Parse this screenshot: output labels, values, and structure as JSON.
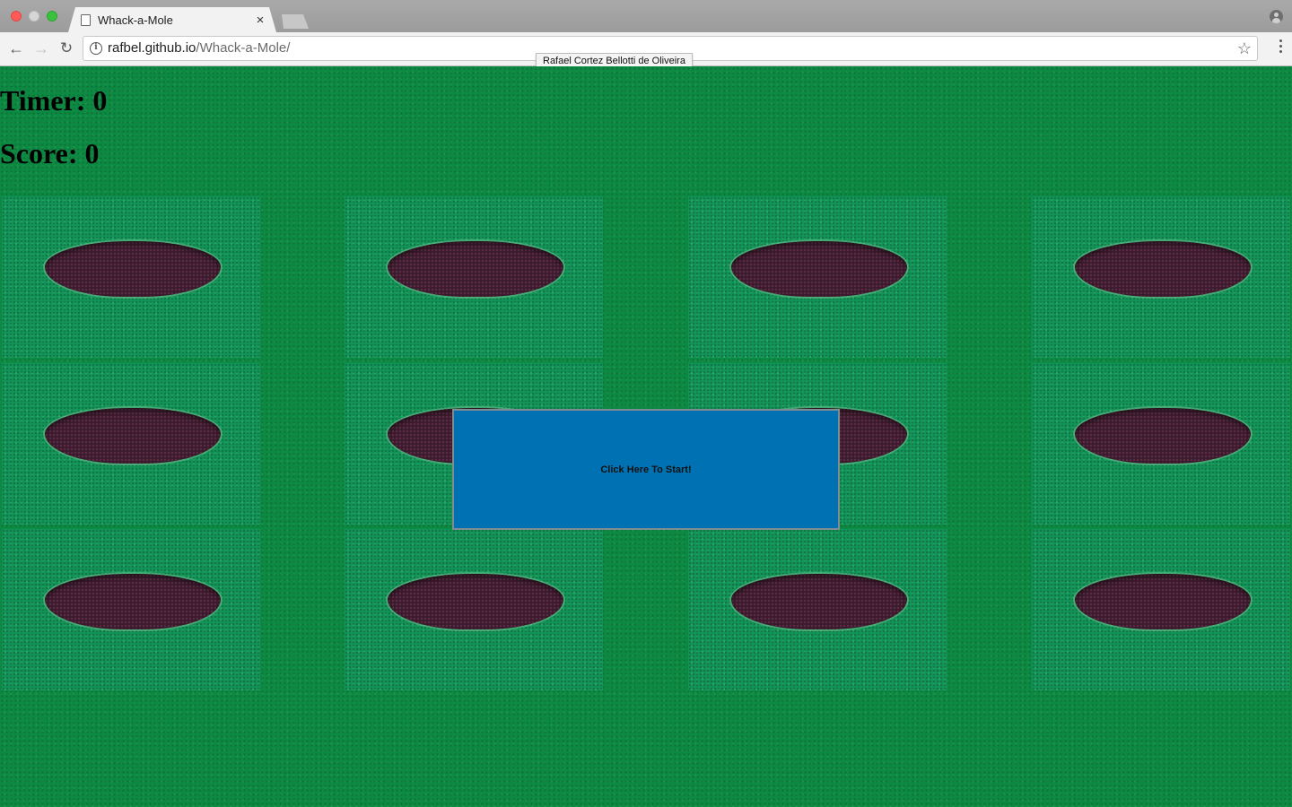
{
  "browser": {
    "tab_title": "Whack-a-Mole",
    "url_host": "rafbel.github.io",
    "url_path": "/Whack-a-Mole/",
    "tooltip": "Rafael Cortez Bellotti de Oliveira"
  },
  "game": {
    "timer_label": "Timer: 0",
    "score_label": "Score: 0",
    "start_button_label": "Click Here To Start!",
    "holes_rows": 3,
    "holes_cols": 4
  },
  "colors": {
    "field_green": "#0c8a43",
    "cell_green": "#12955a",
    "hole_dark": "#3a1a2c",
    "start_button_blue": "#0072b3"
  },
  "icons": [
    "page-icon",
    "close-icon",
    "back-arrow-icon",
    "forward-arrow-icon",
    "reload-icon",
    "info-icon",
    "star-icon",
    "menu-icon",
    "profile-icon"
  ]
}
